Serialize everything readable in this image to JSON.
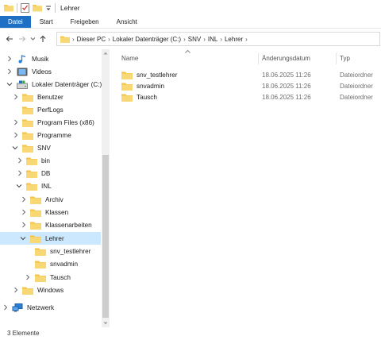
{
  "window": {
    "title": "Lehrer"
  },
  "ribbon": {
    "tabs": [
      "Datei",
      "Start",
      "Freigeben",
      "Ansicht"
    ]
  },
  "address": {
    "crumbs": [
      "Dieser PC",
      "Lokaler Datenträger (C:)",
      "SNV",
      "INL",
      "Lehrer"
    ]
  },
  "nav": {
    "items": [
      {
        "label": "Musik",
        "icon": "music-icon"
      },
      {
        "label": "Videos",
        "icon": "videos-icon"
      },
      {
        "label": "Lokaler Datenträger (C:)",
        "icon": "drive-icon"
      },
      {
        "label": "Benutzer",
        "icon": "folder-icon"
      },
      {
        "label": "PerfLogs",
        "icon": "folder-icon"
      },
      {
        "label": "Program Files (x86)",
        "icon": "folder-icon"
      },
      {
        "label": "Programme",
        "icon": "folder-icon"
      },
      {
        "label": "SNV",
        "icon": "folder-icon"
      },
      {
        "label": "bin",
        "icon": "folder-icon"
      },
      {
        "label": "DB",
        "icon": "folder-icon"
      },
      {
        "label": "INL",
        "icon": "folder-icon"
      },
      {
        "label": "Archiv",
        "icon": "folder-icon"
      },
      {
        "label": "Klassen",
        "icon": "folder-icon"
      },
      {
        "label": "Klassenarbeiten",
        "icon": "folder-icon"
      },
      {
        "label": "Lehrer",
        "icon": "folder-icon"
      },
      {
        "label": "snv_testlehrer",
        "icon": "folder-icon"
      },
      {
        "label": "snvadmin",
        "icon": "folder-icon"
      },
      {
        "label": "Tausch",
        "icon": "folder-icon"
      },
      {
        "label": "Windows",
        "icon": "folder-icon"
      },
      {
        "label": "Netzwerk",
        "icon": "network-icon"
      }
    ]
  },
  "columns": {
    "name": "Name",
    "date": "Änderungsdatum",
    "type": "Typ"
  },
  "files": [
    {
      "name": "snv_testlehrer",
      "date": "18.06.2025 11:26",
      "type": "Dateiordner"
    },
    {
      "name": "snvadmin",
      "date": "18.06.2025 11:26",
      "type": "Dateiordner"
    },
    {
      "name": "Tausch",
      "date": "18.06.2025 11:26",
      "type": "Dateiordner"
    }
  ],
  "status": {
    "count": "3 Elemente"
  },
  "colors": {
    "accent": "#1f6fc5",
    "selection": "#cce8ff",
    "folder": "#f5c242"
  }
}
